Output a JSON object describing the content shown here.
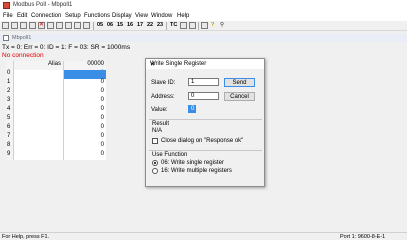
{
  "window": {
    "title": "Modbus Poll - Mbpoll1"
  },
  "menu": [
    "File",
    "Edit",
    "Connection",
    "Setup",
    "Functions",
    "Display",
    "View",
    "Window",
    "Help"
  ],
  "toolbar": {
    "function_codes": [
      "05",
      "06",
      "15",
      "16",
      "17",
      "22",
      "23"
    ],
    "tc_label": "TC"
  },
  "child_window": {
    "title": "Mbpoll1"
  },
  "status": {
    "summary": "Tx = 0: Err = 0: ID = 1: F = 03: SR = 1000ms",
    "connection": "No connection"
  },
  "grid": {
    "header_alias": "Alias",
    "header_value": "00000",
    "rows": [
      {
        "index": "0",
        "value": "0"
      },
      {
        "index": "1",
        "value": "0"
      },
      {
        "index": "2",
        "value": "0"
      },
      {
        "index": "3",
        "value": "0"
      },
      {
        "index": "4",
        "value": "0"
      },
      {
        "index": "5",
        "value": "0"
      },
      {
        "index": "6",
        "value": "0"
      },
      {
        "index": "7",
        "value": "0"
      },
      {
        "index": "8",
        "value": "0"
      },
      {
        "index": "9",
        "value": "0"
      }
    ]
  },
  "dialog": {
    "title": "Write Single Register",
    "slave_label": "Slave ID:",
    "slave_value": "1",
    "address_label": "Address:",
    "address_value": "0",
    "value_label": "Value:",
    "value_value": "0",
    "send_label": "Send",
    "cancel_label": "Cancel",
    "result_label": "Result",
    "result_value": "N/A",
    "close_dialog_label": "Close dialog on \"Response ok\"",
    "use_function_label": "Use Function",
    "func06_label": "06: Write single register",
    "func16_label": "16: Write multiple registers"
  },
  "statusbar": {
    "help": "For Help, press F1.",
    "port": "Port 1: 9600-8-E-1"
  }
}
